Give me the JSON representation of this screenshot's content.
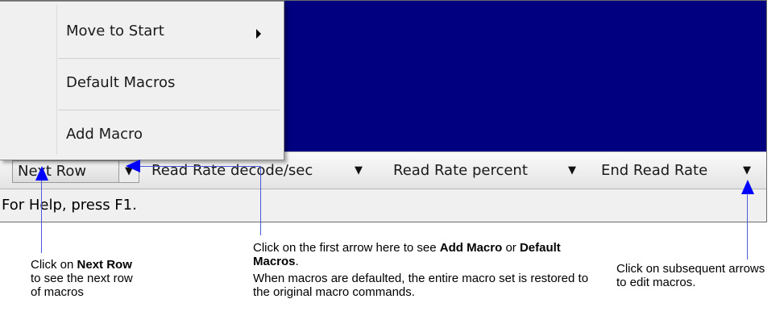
{
  "menu": {
    "items": [
      {
        "label": "Move to Start",
        "has_submenu": true
      },
      {
        "label": "Default Macros",
        "has_submenu": false
      },
      {
        "label": "Add Macro",
        "has_submenu": false
      }
    ]
  },
  "macro_bar": {
    "next_row": "Next Row",
    "read_rate_decode": "Read Rate decode/sec",
    "read_rate_percent": "Read Rate percent",
    "end_read_rate": "End Read Rate",
    "arrow_glyph": "▼"
  },
  "status_bar": {
    "text": "For Help, press F1."
  },
  "callouts": {
    "next_row": {
      "p1": "Click on ",
      "b1": "Next Row",
      "p2": " to see the next row of macros"
    },
    "first_arrow": {
      "p1": "Click on the first arrow here to see ",
      "b1": "Add Macro",
      "p2": " or ",
      "b2": "Default Macros",
      "p3": ".",
      "p4": "When macros are defaulted, the entire macro set is restored to the original macro commands."
    },
    "subsequent": {
      "text": "Click on subsequent arrows to edit macros."
    }
  },
  "colors": {
    "pane_blue": "#000080",
    "callout_arrow": "#0000ff"
  }
}
